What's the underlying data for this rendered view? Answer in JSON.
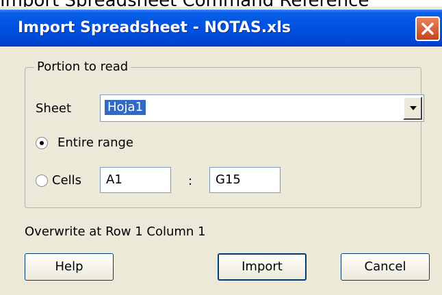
{
  "background": {
    "text": "Import Spreadsheet Command Reference"
  },
  "dialog": {
    "title": "Import Spreadsheet - NOTAS.xls",
    "close_icon": "close-x-icon",
    "accent_color": "#0054e3",
    "close_color": "#d64a1f"
  },
  "portion": {
    "legend": "Portion to read",
    "sheet_label": "Sheet",
    "sheet_value": "Hoja1",
    "entire_range_label": "Entire range",
    "entire_range_selected": true,
    "cells_label": "Cells",
    "cells_selected": false,
    "cells_from": "A1",
    "range_separator": ":",
    "cells_to": "G15"
  },
  "status": {
    "overwrite_text": "Overwrite at Row 1 Column 1"
  },
  "buttons": {
    "help": "Help",
    "import": "Import",
    "cancel": "Cancel"
  }
}
